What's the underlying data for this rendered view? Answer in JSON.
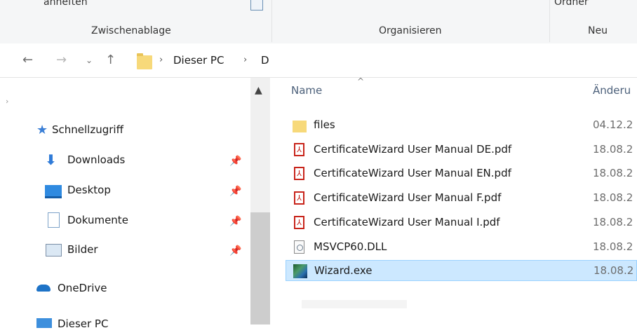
{
  "ribbon": {
    "top_cut_left": "anheften",
    "top_cut_right": "Ordner",
    "groups": [
      "Zwischenablage",
      "Organisieren",
      "Neu"
    ]
  },
  "address": {
    "back_icon": "back-arrow-icon",
    "forward_icon": "forward-arrow-icon",
    "recent_icon": "chevron-down-icon",
    "up_icon": "up-arrow-icon",
    "crumbs": [
      "Dieser PC",
      "D"
    ]
  },
  "nav": {
    "quick_access": "Schnellzugriff",
    "items": [
      {
        "label": "Downloads",
        "icon": "downloads-icon",
        "pinned": true
      },
      {
        "label": "Desktop",
        "icon": "desktop-icon",
        "pinned": true
      },
      {
        "label": "Dokumente",
        "icon": "documents-icon",
        "pinned": true
      },
      {
        "label": "Bilder",
        "icon": "pictures-icon",
        "pinned": true
      }
    ],
    "onedrive": "OneDrive",
    "this_pc_cut": "Dieser PC"
  },
  "list": {
    "columns": [
      "Name",
      "Änderu"
    ],
    "rows": [
      {
        "name": "files",
        "date": "04.12.2",
        "type": "folder",
        "selected": false
      },
      {
        "name": "CertificateWizard User Manual DE.pdf",
        "date": "18.08.2",
        "type": "pdf",
        "selected": false
      },
      {
        "name": "CertificateWizard User Manual EN.pdf",
        "date": "18.08.2",
        "type": "pdf",
        "selected": false
      },
      {
        "name": "CertificateWizard User Manual F.pdf",
        "date": "18.08.2",
        "type": "pdf",
        "selected": false
      },
      {
        "name": "CertificateWizard User Manual I.pdf",
        "date": "18.08.2",
        "type": "pdf",
        "selected": false
      },
      {
        "name": "MSVCP60.DLL",
        "date": "18.08.2",
        "type": "dll",
        "selected": false
      },
      {
        "name": "Wizard.exe",
        "date": "18.08.2",
        "type": "exe",
        "selected": true
      }
    ]
  },
  "colors": {
    "selection": "#cce8ff",
    "selection_border": "#99d1ff",
    "accent": "#0078d7"
  }
}
